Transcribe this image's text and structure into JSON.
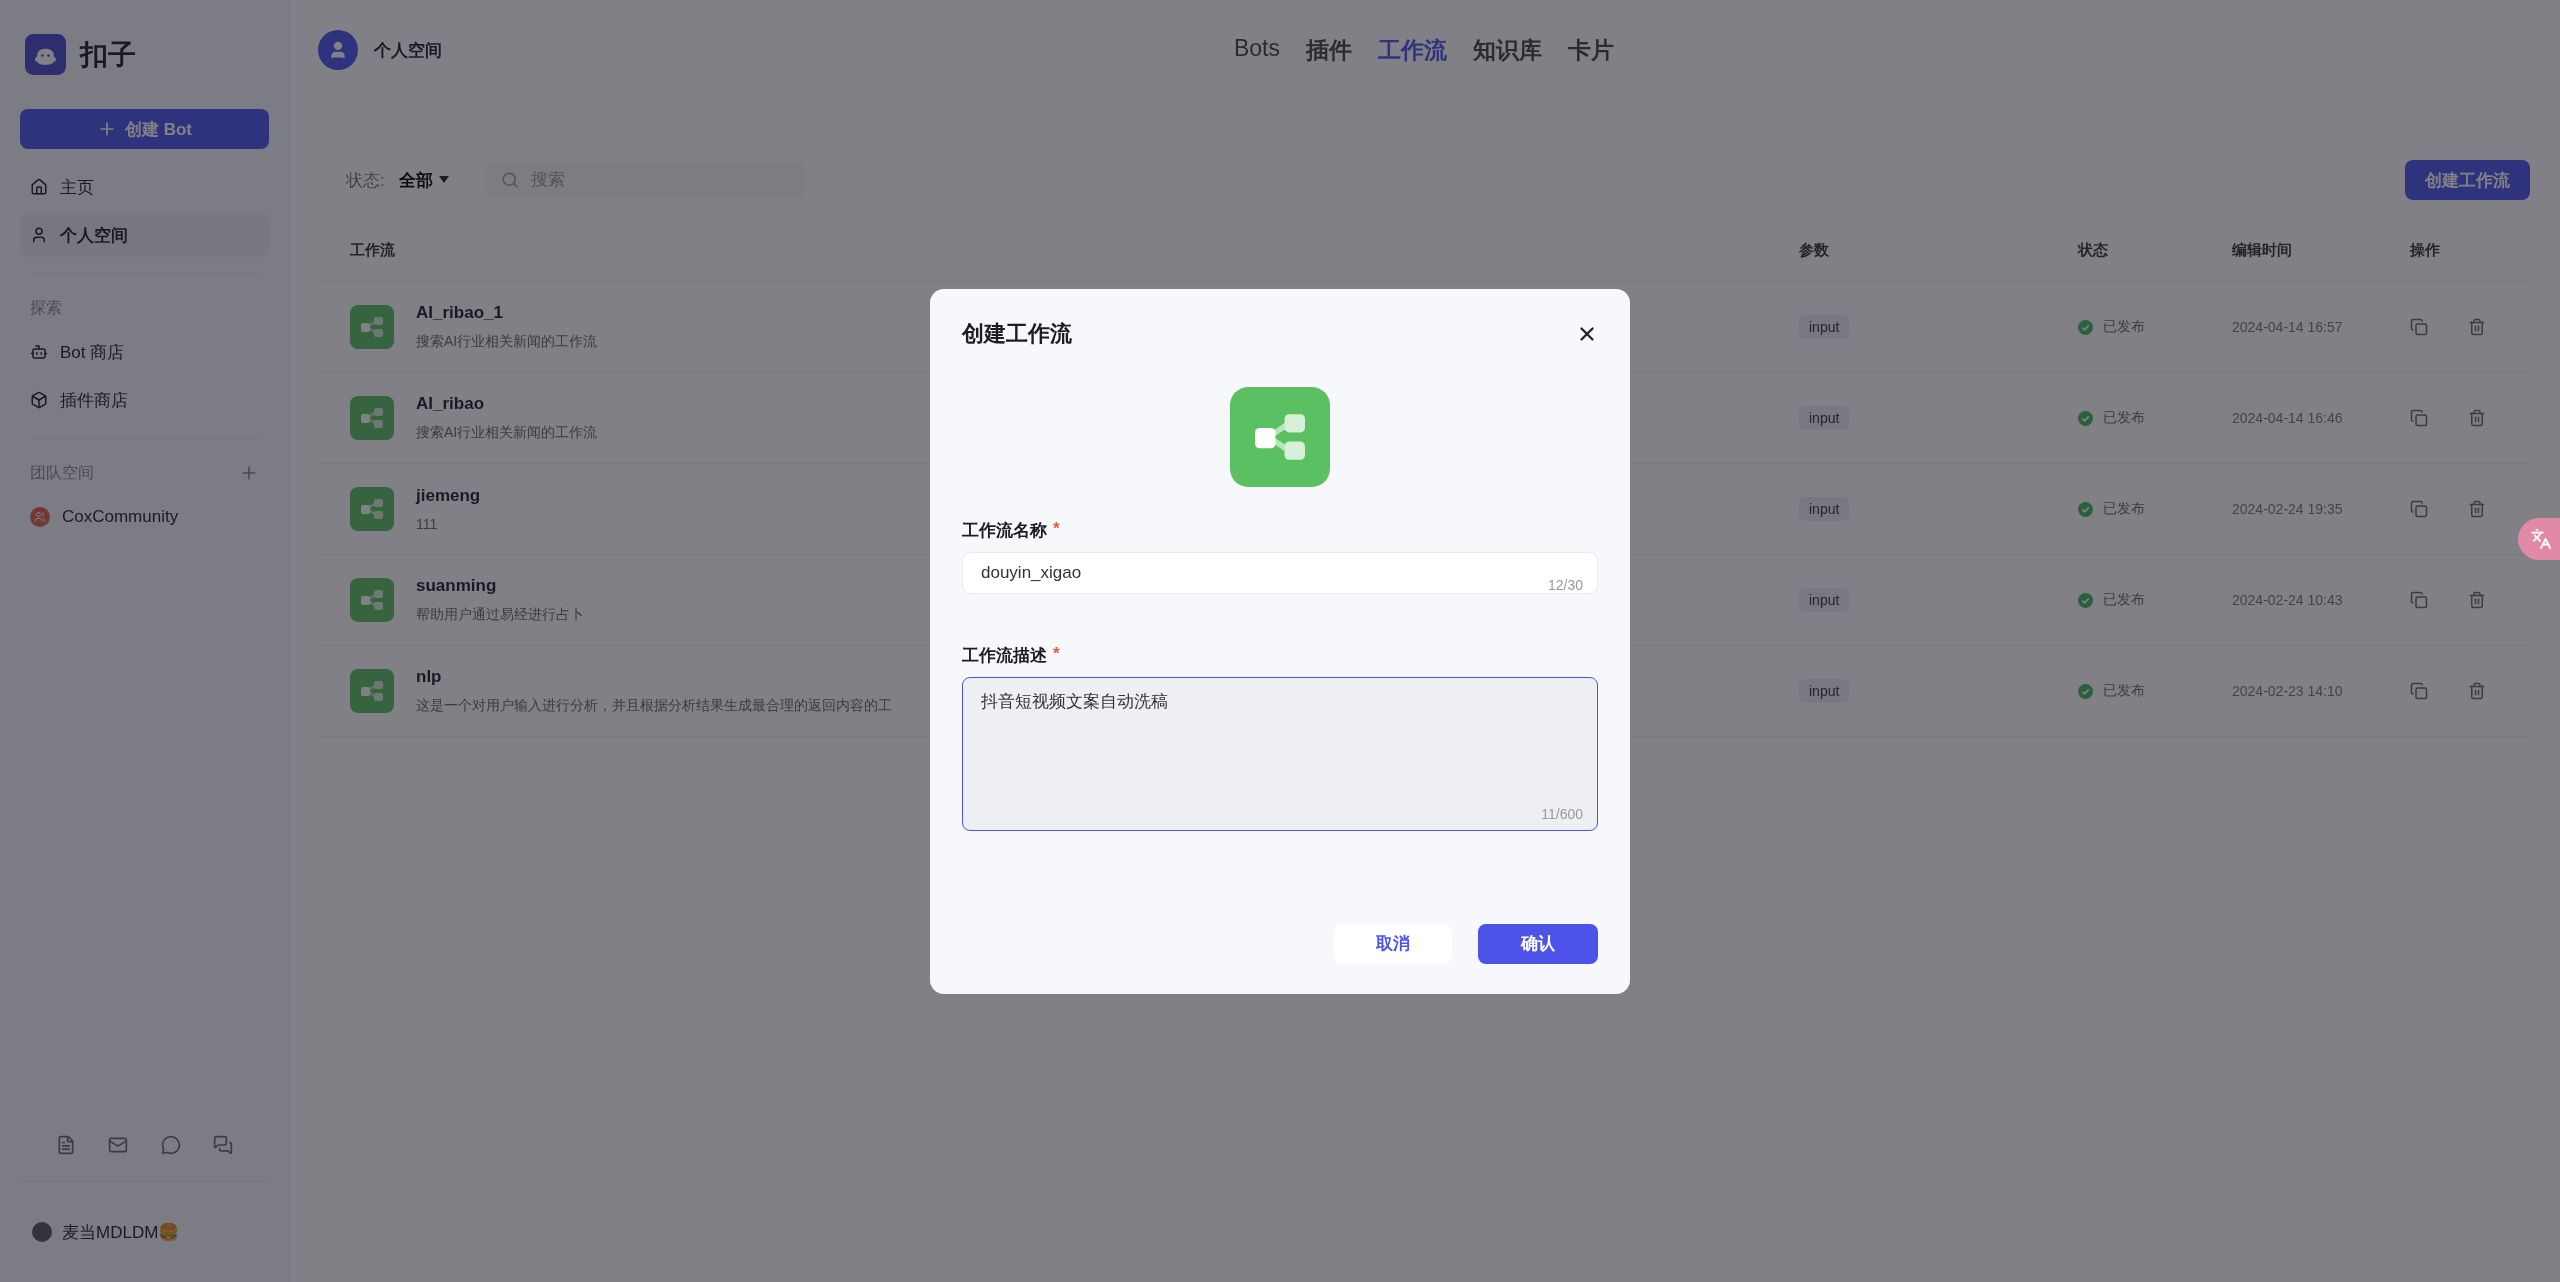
{
  "sidebar": {
    "logo_text": "扣子",
    "create_button": "创建 Bot",
    "nav": [
      {
        "label": "主页",
        "kind": "home",
        "selected": false
      },
      {
        "label": "个人空间",
        "kind": "user",
        "selected": true
      }
    ],
    "explore": {
      "heading": "探索",
      "items": [
        {
          "label": "Bot 商店",
          "kind": "bot",
          "selected": false
        },
        {
          "label": "插件商店",
          "kind": "box",
          "selected": false
        }
      ]
    },
    "team": {
      "heading": "团队空间",
      "items": [
        {
          "label": "CoxCommunity",
          "selected": false
        }
      ]
    },
    "user": {
      "name": "麦当MDLDM🍔"
    }
  },
  "header": {
    "space": "个人空间",
    "tabs": [
      {
        "label": "Bots",
        "selected": false
      },
      {
        "label": "插件",
        "selected": false
      },
      {
        "label": "工作流",
        "selected": true
      },
      {
        "label": "知识库",
        "selected": false
      },
      {
        "label": "卡片",
        "selected": false
      }
    ]
  },
  "toolbar": {
    "filter_label": "状态:",
    "filter_value": "全部",
    "search": {
      "placeholder": "搜索"
    },
    "create_button": "创建工作流"
  },
  "table": {
    "columns": [
      "工作流",
      "参数",
      "状态",
      "编辑时间",
      "操作"
    ],
    "rows": [
      {
        "name": "AI_ribao_1",
        "description": "搜索AI行业相关新闻的工作流",
        "param": "input",
        "status": "已发布",
        "edited": "2024-04-14 16:57"
      },
      {
        "name": "AI_ribao",
        "description": "搜索AI行业相关新闻的工作流",
        "param": "input",
        "status": "已发布",
        "edited": "2024-04-14 16:46"
      },
      {
        "name": "jiemeng",
        "description": "111",
        "param": "input",
        "status": "已发布",
        "edited": "2024-02-24 19:35"
      },
      {
        "name": "suanming",
        "description": "帮助用户通过易经进行占卜",
        "param": "input",
        "status": "已发布",
        "edited": "2024-02-24 10:43"
      },
      {
        "name": "nlp",
        "description": "这是一个对用户输入进行分析，并且根据分析结果生成最合理的返回内容的工",
        "param": "input",
        "status": "已发布",
        "edited": "2024-02-23 14:10"
      }
    ]
  },
  "dialog": {
    "title": "创建工作流",
    "fields": [
      {
        "kind": "input",
        "label": "工作流名称",
        "required_mark": "*",
        "value": "douyin_xigao",
        "counter": "12/30",
        "focused": false
      },
      {
        "kind": "textarea",
        "label": "工作流描述",
        "required_mark": "*",
        "value": "抖音短视频文案自动洗稿",
        "counter": "11/600",
        "focused": true
      }
    ],
    "buttons": [
      {
        "label": "取消",
        "kind": "secondary"
      },
      {
        "label": "确认",
        "kind": "primary"
      }
    ]
  }
}
